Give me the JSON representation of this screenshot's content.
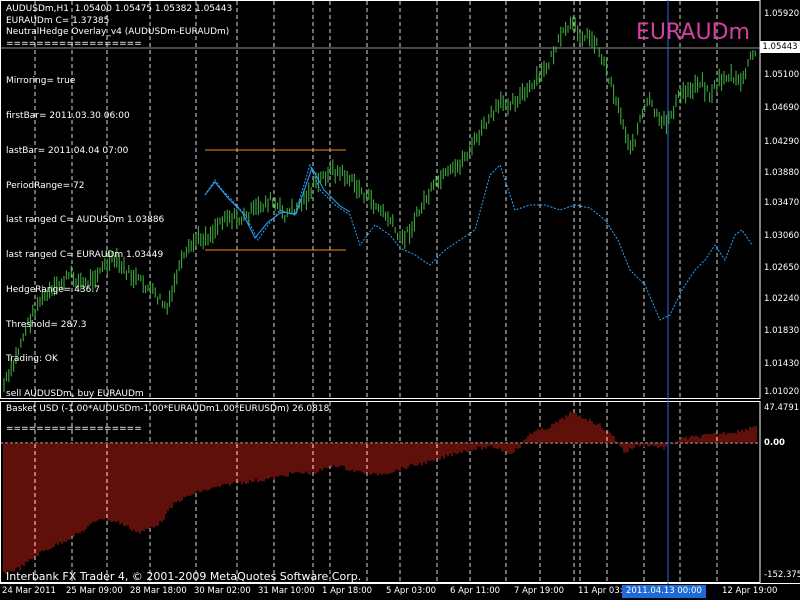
{
  "header": {
    "symbol_line": "AUDUSDm,H1  1.05400 1.05475 1.05382 1.05443",
    "second_symbol_line": "EURAUDm C= 1.37385",
    "indicator_line": "NeutralHedge Overlay_v4 (AUDUSDm-EURAUDm)",
    "separator": "=================="
  },
  "indicator_info": [
    "Mirroring= true",
    "firstBar= 2011.03.30 06:00",
    "lastBar= 2011.04.04 07:00",
    "PeriodRange= 72",
    "last ranged C= AUDUSDm 1.03886",
    "last ranged C= EURAUDm 1.03449",
    "HedgeRange= 436.7",
    "Threshold= 287.3",
    "Trading: OK",
    "sell AUDUSDm, buy EURAUDm",
    "=================="
  ],
  "watermark": "EURAUDm",
  "price_axis": [
    "1.05920",
    "1.05443",
    "1.05100",
    "1.04690",
    "1.04290",
    "1.03880",
    "1.03470",
    "1.03060",
    "1.02650",
    "1.02240",
    "1.01830",
    "1.01430",
    "1.01020"
  ],
  "current_price": "1.05443",
  "subpane": {
    "title": "Basket USD (-1.00*AUDUSDm-1.00*EURAUDm1.00*EURUSDm) 26.0818",
    "max_label": "47.4791",
    "zero_label": "0.00",
    "min_label": "-152.375"
  },
  "time_axis": [
    "24 Mar 2011",
    "25 Mar 09:00",
    "28 Mar 18:00",
    "30 Mar 02:00",
    "31 Mar 10:00",
    "1 Apr 18:00",
    "5 Apr 03:00",
    "6 Apr 11:00",
    "7 Apr 19:00",
    "11 Apr 03:00",
    "",
    "12 Apr 19:00"
  ],
  "crosshair_time": "2011.04.13 00:00",
  "copyright": "Interbank FX Trader 4, © 2001-2009 MetaQuotes Software Corp.",
  "colors": {
    "bars": "#3fa83f",
    "overlay": "#2aa6ff",
    "range_lines": "#f08c14",
    "histogram": "#b01e14",
    "crosshair": "#2a6bd6",
    "watermark": "#d63fa0"
  }
}
